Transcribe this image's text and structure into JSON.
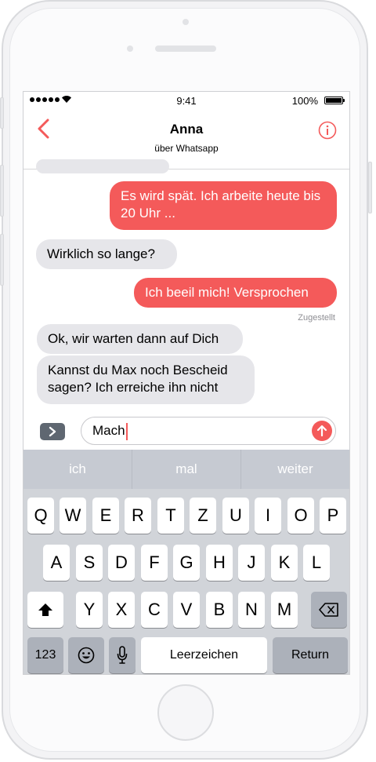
{
  "status": {
    "time": "9:41",
    "battery": "100%"
  },
  "header": {
    "contact": "Anna",
    "subtitle": "über Whatsapp"
  },
  "messages": [
    {
      "side": "out",
      "text": "Es wird spät. Ich arbeite heute bis 20 Uhr ..."
    },
    {
      "side": "in",
      "text": "Wirklich so lange?"
    },
    {
      "side": "out",
      "text": "Ich beeil mich! Versprochen"
    },
    {
      "side": "in",
      "text": "Ok, wir warten dann auf Dich"
    },
    {
      "side": "in",
      "text": "Kannst du Max noch Bescheid sagen? Ich erreiche ihn nicht"
    }
  ],
  "delivered": "Zugestellt",
  "composer": {
    "value": "Mach"
  },
  "suggestions": [
    "ich",
    "mal",
    "weiter"
  ],
  "keys": {
    "row1": [
      "Q",
      "W",
      "E",
      "R",
      "T",
      "Z",
      "U",
      "I",
      "O",
      "P"
    ],
    "row2": [
      "A",
      "S",
      "D",
      "F",
      "G",
      "H",
      "J",
      "K",
      "L"
    ],
    "row3": [
      "Y",
      "X",
      "C",
      "V",
      "B",
      "N",
      "M"
    ],
    "numbers": "123",
    "space": "Leerzeichen",
    "return": "Return"
  },
  "colors": {
    "accent": "#f45a5a",
    "incoming": "#e6e6ea",
    "keyboard": "#d1d4d9"
  }
}
